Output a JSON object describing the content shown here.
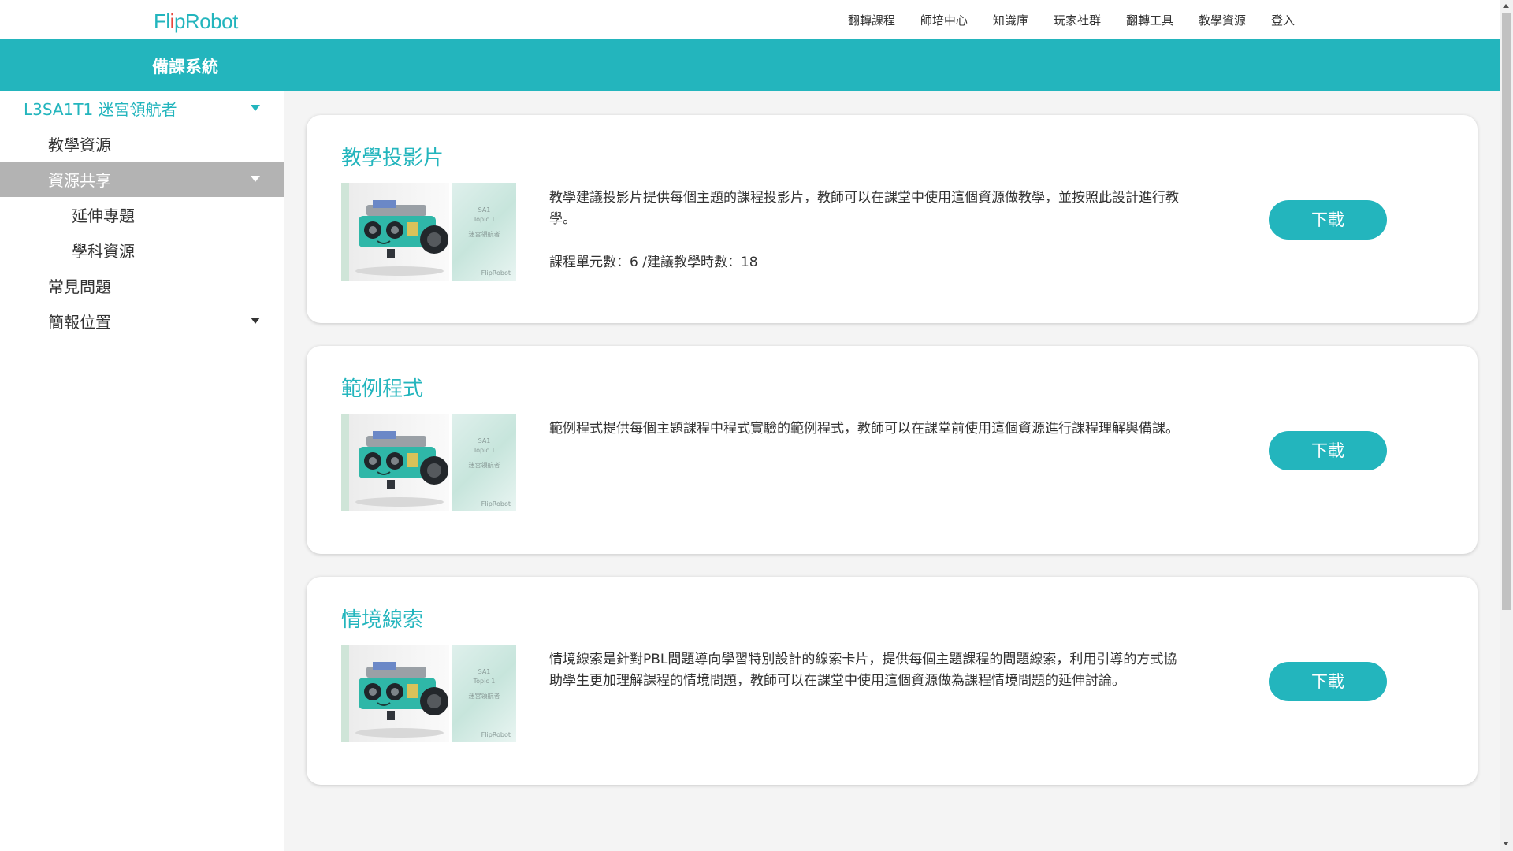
{
  "brand": {
    "logo": "FlipRobot",
    "accent": "#23b5bd"
  },
  "nav": {
    "items": [
      "翻轉課程",
      "師培中心",
      "知識庫",
      "玩家社群",
      "翻轉工具",
      "教學資源",
      "登入"
    ]
  },
  "header": {
    "title": "備課系統"
  },
  "sidebar": {
    "items": [
      {
        "label": "L3SA1T1 迷宮領航者",
        "icon": "chevron-down-icon"
      },
      {
        "label": "教學資源"
      },
      {
        "label": "資源共享",
        "icon": "chevron-down-icon"
      },
      {
        "label": "延伸專題"
      },
      {
        "label": "學科資源"
      },
      {
        "label": "常見問題"
      },
      {
        "label": "簡報位置",
        "icon": "chevron-down-icon"
      }
    ]
  },
  "thumbnail": {
    "code": "SA1",
    "topic": "Topic 1",
    "title": "迷宮領航者",
    "brand": "FlipRobot"
  },
  "cards": [
    {
      "title": "教學投影片",
      "description": "教學建議投影片提供每個主題的課程投影片，教師可以在課堂中使用這個資源做教學，並按照此設計進行教學。",
      "meta": "課程單元數：6 /建議教學時數：18",
      "button": "下載"
    },
    {
      "title": "範例程式",
      "description": "範例程式提供每個主題課程中程式實驗的範例程式，教師可以在課堂前使用這個資源進行課程理解與備課。",
      "button": "下載"
    },
    {
      "title": "情境線索",
      "description": "情境線索是針對PBL問題導向學習特別設計的線索卡片，提供每個主題課程的問題線索，利用引導的方式協助學生更加理解課程的情境問題，教師可以在課堂中使用這個資源做為課程情境問題的延伸討論。",
      "button": "下載"
    }
  ]
}
